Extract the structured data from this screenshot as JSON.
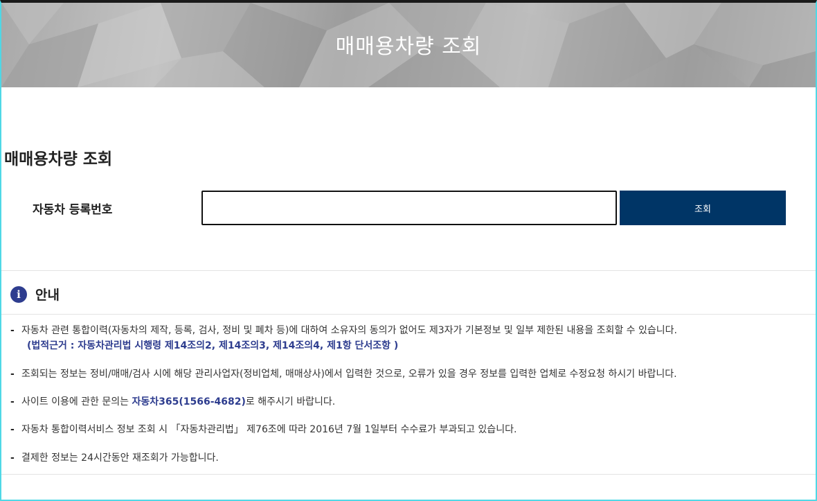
{
  "hero": {
    "title": "매매용차량 조회"
  },
  "section": {
    "title": "매매용차량 조회"
  },
  "form": {
    "label": "자동차 등록번호",
    "input_value": "",
    "button_label": "조회"
  },
  "notice": {
    "icon": "info-icon",
    "title": "안내",
    "b1": "자동차 관련 통합이력(자동차의 제작, 등록, 검사, 정비 및 폐차 등)에 대하여 소유자의 동의가 없어도 제3자가 기본정보 및 일부 제한된 내용을 조회할 수 있습니다.",
    "b1_sub": "(법적근거 : 자동차관리법 시행령 제14조의2, 제14조의3, 제14조의4, 제1항 단서조항 )",
    "b2": "조회되는 정보는 정비/매매/검사 시에 해당 관리사업자(정비업체, 매매상사)에서 입력한 것으로, 오류가 있을 경우 정보를 입력한 업체로 수정요청 하시기 바랍니다.",
    "b3_pre": "사이트 이용에 관한 문의는 ",
    "b3_hl": "자동차365(1566-4682)",
    "b3_post": "로 해주시기 바랍니다.",
    "b4": "자동차 통합이력서비스 정보 조회 시 「자동차관리법」 제76조에 따라 2016년 7월 1일부터 수수료가 부과되고 있습니다.",
    "b5": "결제한 정보는 24시간동안 재조회가 가능합니다."
  },
  "colors": {
    "button_bg": "#003566",
    "highlight": "#2e3d8f",
    "frame_border": "#4fd8e6"
  }
}
